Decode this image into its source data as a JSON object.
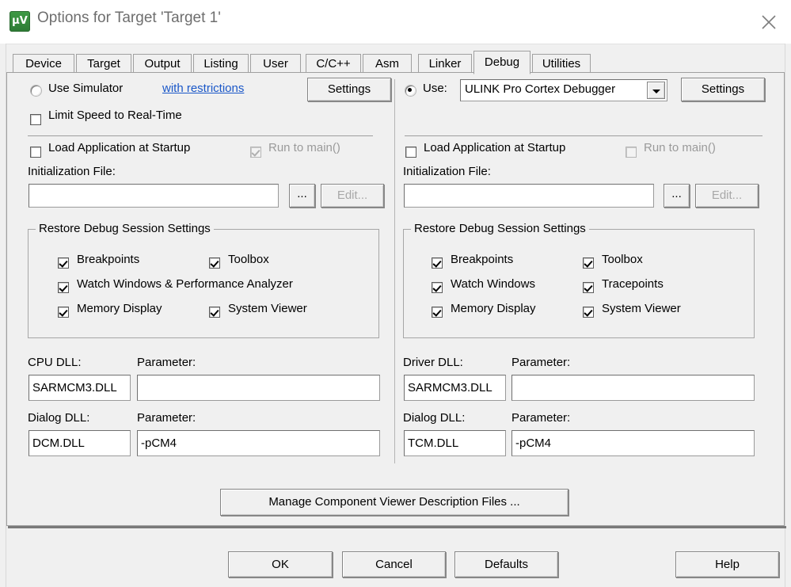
{
  "window": {
    "title": "Options for Target 'Target 1'",
    "icon": "uvision-icon",
    "close_icon": "close-icon"
  },
  "tabs": [
    {
      "label": "Device",
      "active": false
    },
    {
      "label": "Target",
      "active": false
    },
    {
      "label": "Output",
      "active": false
    },
    {
      "label": "Listing",
      "active": false
    },
    {
      "label": "User",
      "active": false
    },
    {
      "label": "C/C++",
      "active": false
    },
    {
      "label": "Asm",
      "active": false
    },
    {
      "label": "Linker",
      "active": false
    },
    {
      "label": "Debug",
      "active": true
    },
    {
      "label": "Utilities",
      "active": false
    }
  ],
  "left_panel": {
    "use_simulator_label": "Use Simulator",
    "use_simulator_checked": false,
    "restrictions_link": "with restrictions",
    "settings_button": "Settings",
    "limit_speed_label": "Limit Speed to Real-Time",
    "limit_speed_checked": false,
    "load_app_label": "Load Application at Startup",
    "load_app_checked": false,
    "run_to_main_label": "Run to main()",
    "run_to_main_checked": true,
    "run_to_main_enabled": false,
    "init_file_label": "Initialization File:",
    "init_file_value": "",
    "browse_button": "...",
    "edit_button": "Edit...",
    "edit_enabled": false,
    "group_title": "Restore Debug Session Settings",
    "restore_items": [
      {
        "label": "Breakpoints",
        "checked": true
      },
      {
        "label": "Toolbox",
        "checked": true
      },
      {
        "label": "Watch Windows & Performance Analyzer",
        "checked": true
      },
      {
        "label": "Memory Display",
        "checked": true
      },
      {
        "label": "System Viewer",
        "checked": true
      }
    ],
    "cpu_dll_label": "CPU DLL:",
    "cpu_dll_value": "SARMCM3.DLL",
    "cpu_param_label": "Parameter:",
    "cpu_param_value": "",
    "dialog_dll_label": "Dialog DLL:",
    "dialog_dll_value": "DCM.DLL",
    "dialog_param_label": "Parameter:",
    "dialog_param_value": "-pCM4"
  },
  "right_panel": {
    "use_label": "Use:",
    "use_checked": true,
    "debugger_selected": "ULINK Pro Cortex Debugger",
    "settings_button": "Settings",
    "load_app_label": "Load Application at Startup",
    "load_app_checked": false,
    "run_to_main_label": "Run to main()",
    "run_to_main_checked": false,
    "run_to_main_enabled": false,
    "init_file_label": "Initialization File:",
    "init_file_value": "",
    "browse_button": "...",
    "edit_button": "Edit...",
    "edit_enabled": false,
    "group_title": "Restore Debug Session Settings",
    "restore_items": [
      {
        "label": "Breakpoints",
        "checked": true
      },
      {
        "label": "Toolbox",
        "checked": true
      },
      {
        "label": "Watch Windows",
        "checked": true
      },
      {
        "label": "Tracepoints",
        "checked": true
      },
      {
        "label": "Memory Display",
        "checked": true
      },
      {
        "label": "System Viewer",
        "checked": true
      }
    ],
    "driver_dll_label": "Driver DLL:",
    "driver_dll_value": "SARMCM3.DLL",
    "driver_param_label": "Parameter:",
    "driver_param_value": "",
    "dialog_dll_label": "Dialog DLL:",
    "dialog_dll_value": "TCM.DLL",
    "dialog_param_label": "Parameter:",
    "dialog_param_value": "-pCM4"
  },
  "manage_button": "Manage Component Viewer Description Files ...",
  "footer": {
    "ok": "OK",
    "cancel": "Cancel",
    "defaults": "Defaults",
    "help": "Help"
  },
  "colors": {
    "dialog_bg": "#f0f0f0",
    "link": "#1a57c8",
    "icon_green": "#3f9b45",
    "disabled_text": "#9a9a9a"
  }
}
